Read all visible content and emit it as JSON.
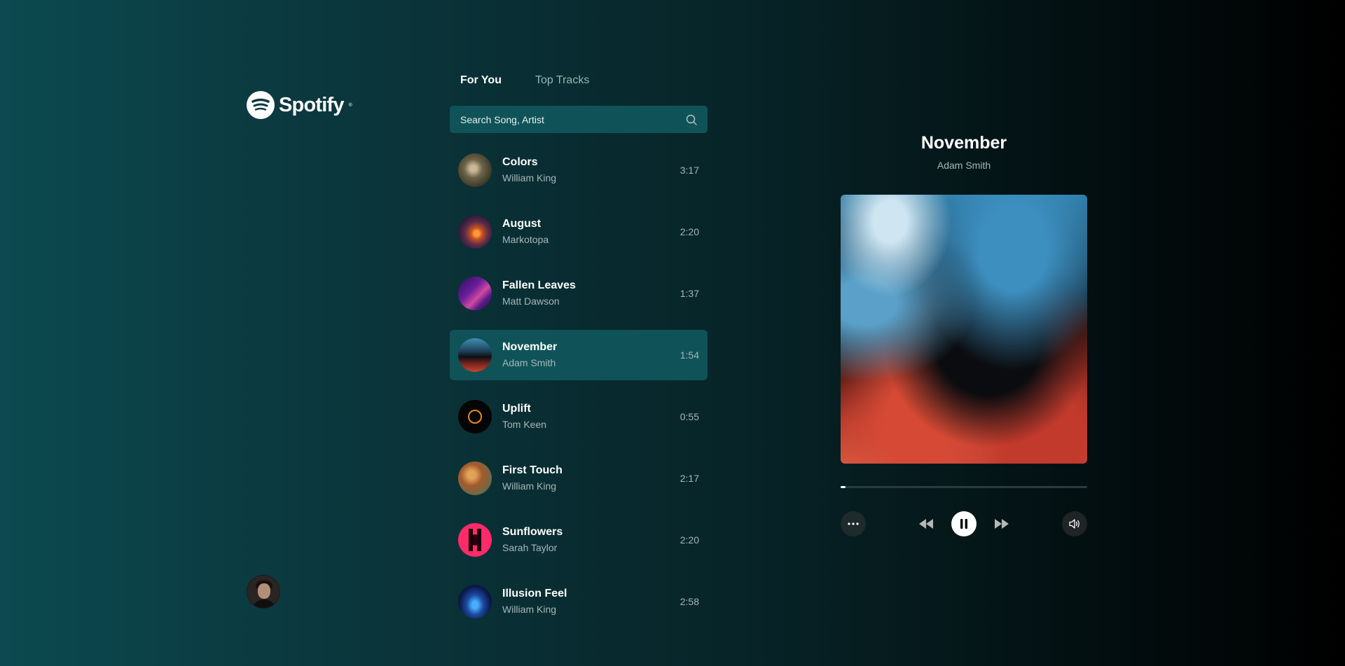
{
  "brand": {
    "name": "Spotify",
    "reg": "®"
  },
  "tabs": [
    {
      "label": "For You",
      "active": true
    },
    {
      "label": "Top Tracks",
      "active": false
    }
  ],
  "search": {
    "placeholder": "Search Song, Artist",
    "value": "",
    "icon": "search-icon"
  },
  "tracks": [
    {
      "title": "Colors",
      "artist": "William King",
      "duration": "3:17",
      "active": false
    },
    {
      "title": "August",
      "artist": "Markotopa",
      "duration": "2:20",
      "active": false
    },
    {
      "title": "Fallen Leaves",
      "artist": "Matt Dawson",
      "duration": "1:37",
      "active": false
    },
    {
      "title": "November",
      "artist": "Adam Smith",
      "duration": "1:54",
      "active": true
    },
    {
      "title": "Uplift",
      "artist": "Tom Keen",
      "duration": "0:55",
      "active": false
    },
    {
      "title": "First Touch",
      "artist": "William King",
      "duration": "2:17",
      "active": false
    },
    {
      "title": "Sunflowers",
      "artist": "Sarah Taylor",
      "duration": "2:20",
      "active": false
    },
    {
      "title": "Illusion Feel",
      "artist": "William King",
      "duration": "2:58",
      "active": false
    }
  ],
  "now_playing": {
    "title": "November",
    "artist": "Adam Smith",
    "progress": 0.02,
    "state": "playing"
  },
  "controls": {
    "more": "more-icon",
    "previous": "rewind-icon",
    "play_pause": "pause-icon",
    "next": "fast-forward-icon",
    "volume": "volume-icon"
  },
  "colors": {
    "accent_panel": "#0f5358",
    "text_muted": "#a7b8ba",
    "bg_left": "#0b4a50",
    "bg_right": "#000000"
  }
}
